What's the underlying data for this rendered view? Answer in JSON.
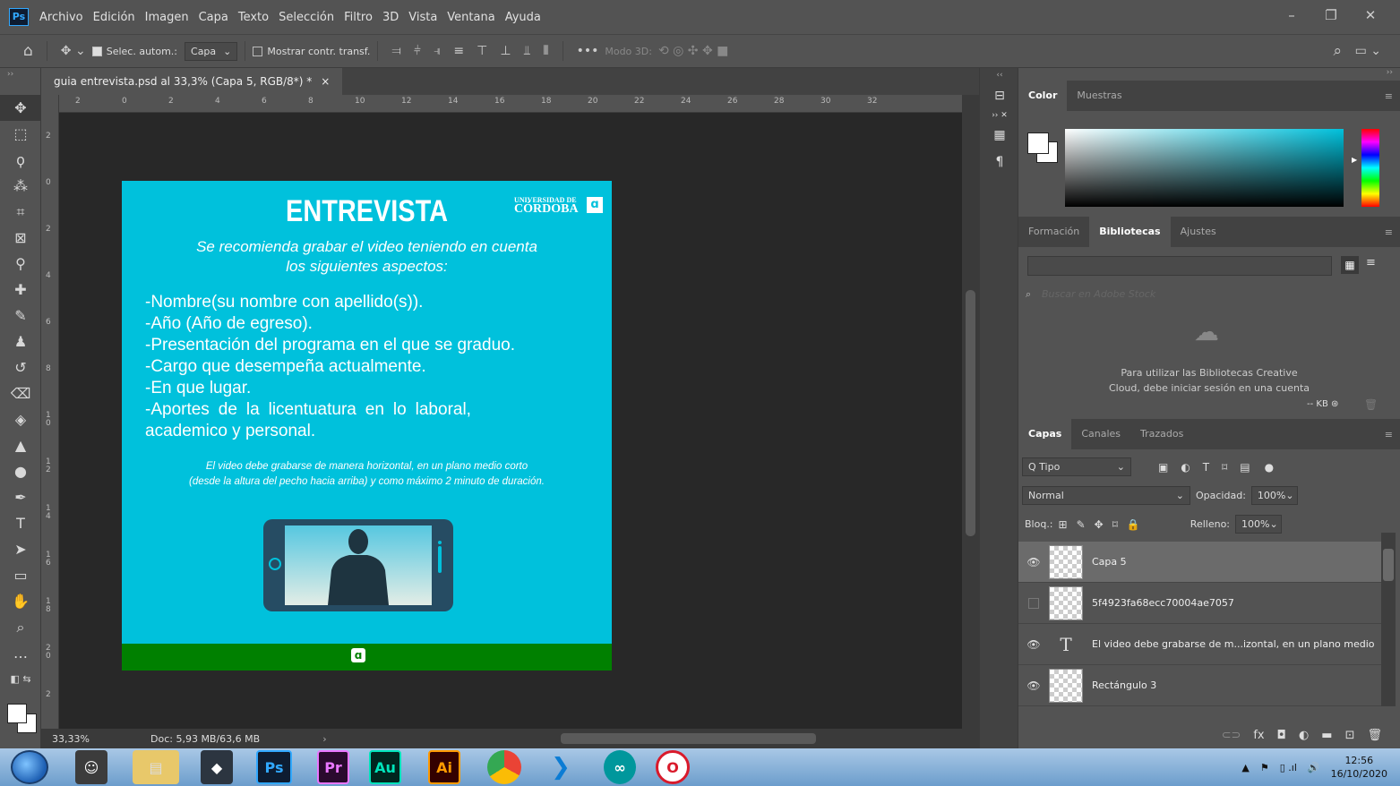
{
  "menubar": {
    "app_icon": "Ps",
    "items": [
      "Archivo",
      "Edición",
      "Imagen",
      "Capa",
      "Texto",
      "Selección",
      "Filtro",
      "3D",
      "Vista",
      "Ventana",
      "Ayuda"
    ],
    "window_controls": [
      "minimize-icon",
      "restore-icon",
      "close-icon"
    ]
  },
  "options": {
    "auto_select_label": "Selec. autom.:",
    "auto_select_value": "Capa",
    "show_transform_label": "Mostrar contr. transf.",
    "mode_3d_label": "Modo 3D:",
    "more_label": "•••"
  },
  "document": {
    "tab_title": "guia entrevista.psd al 33,3% (Capa 5, RGB/8*) *",
    "tab_close": "×",
    "zoom": "33,33%",
    "doc_size": "Doc: 5,93 MB/63,6 MB",
    "ruler_h": [
      "2",
      "0",
      "2",
      "4",
      "6",
      "8",
      "10",
      "12",
      "14",
      "16",
      "18",
      "20",
      "22",
      "24",
      "26",
      "28",
      "30",
      "32"
    ],
    "ruler_v": [
      "2",
      "0",
      "2",
      "4",
      "6",
      "8",
      "1\n0",
      "1\n2",
      "1\n4",
      "1\n6",
      "1\n8",
      "2\n0",
      "2"
    ]
  },
  "artwork": {
    "title": "ENTREVISTA",
    "logo_line1": "UNIVERSIDAD DE",
    "logo_line2": "CÓRDOBA",
    "subtitle1": "Se recomienda grabar el video teniendo en cuenta",
    "subtitle2": "los siguientes aspectos:",
    "list": [
      "-Nombre(su nombre con apellido(s)).",
      "-Año (Año de egreso).",
      "-Presentación del programa en el que se graduo.",
      "-Cargo que desempeña actualmente.",
      "-En que lugar."
    ],
    "list_justified": [
      "-Aportes",
      "de",
      "la",
      "licentuatura",
      "en",
      "lo",
      "laboral,"
    ],
    "list_last": "academico y personal.",
    "note1": "El video debe grabarse de manera horizontal, en un plano medio corto",
    "note2": "(desde la altura del pecho hacia arriba) y como máximo 2 minuto de duración.",
    "colors": {
      "background": "#00c1dc",
      "footer": "#008000",
      "phone": "#264c63"
    }
  },
  "color_panel": {
    "tabs": [
      "Color",
      "Muestras"
    ],
    "foreground": "#ffffff",
    "background": "#ffffff"
  },
  "libraries_panel": {
    "tabs": [
      "Formación",
      "Bibliotecas",
      "Ajustes"
    ],
    "search_placeholder": "Buscar en Adobe Stock",
    "message1": "Para utilizar las Bibliotecas Creative",
    "message2": "Cloud, debe iniciar sesión en una cuenta",
    "kb_label": "-- KB"
  },
  "layers_panel": {
    "tabs": [
      "Capas",
      "Canales",
      "Trazados"
    ],
    "filter_label": "Q Tipo",
    "blend_mode": "Normal",
    "opacity_label": "Opacidad:",
    "opacity_value": "100%",
    "lock_label": "Bloq.:",
    "fill_label": "Relleno:",
    "fill_value": "100%",
    "layers": [
      {
        "name": "Capa 5",
        "kind": "pixel",
        "visible": true,
        "selected": true
      },
      {
        "name": "5f4923fa68ecc70004ae7057",
        "kind": "smart",
        "visible": false,
        "selected": false
      },
      {
        "name": "El video debe grabarse de m...izontal, en un plano medio",
        "kind": "text",
        "visible": true,
        "selected": false
      },
      {
        "name": "Rectángulo 3",
        "kind": "shape",
        "visible": true,
        "selected": false
      }
    ]
  },
  "taskbar": {
    "apps": [
      "Ps",
      "Pr",
      "Au",
      "Ai"
    ],
    "time": "12:56",
    "date": "16/10/2020"
  }
}
